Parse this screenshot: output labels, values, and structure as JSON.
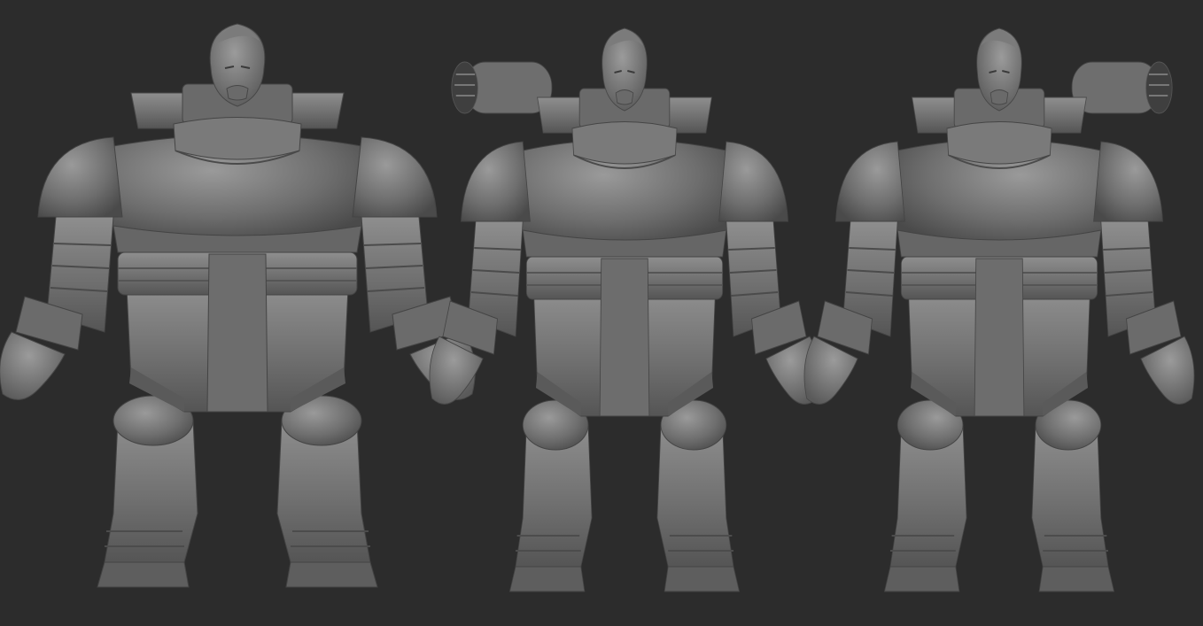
{
  "scene": {
    "subject": "armored-character-sculpt",
    "views": [
      {
        "id": "front",
        "label": ""
      },
      {
        "id": "three-quarter-left",
        "label": ""
      },
      {
        "id": "three-quarter-right",
        "label": ""
      }
    ]
  },
  "colors": {
    "background": "#2c2c2c",
    "clay_dark": "#3e3e3e",
    "clay_mid": "#5f5f5f",
    "clay_base": "#6f6f6f",
    "clay_light": "#8e8e8e",
    "clay_highlight": "#a5a5a5"
  }
}
